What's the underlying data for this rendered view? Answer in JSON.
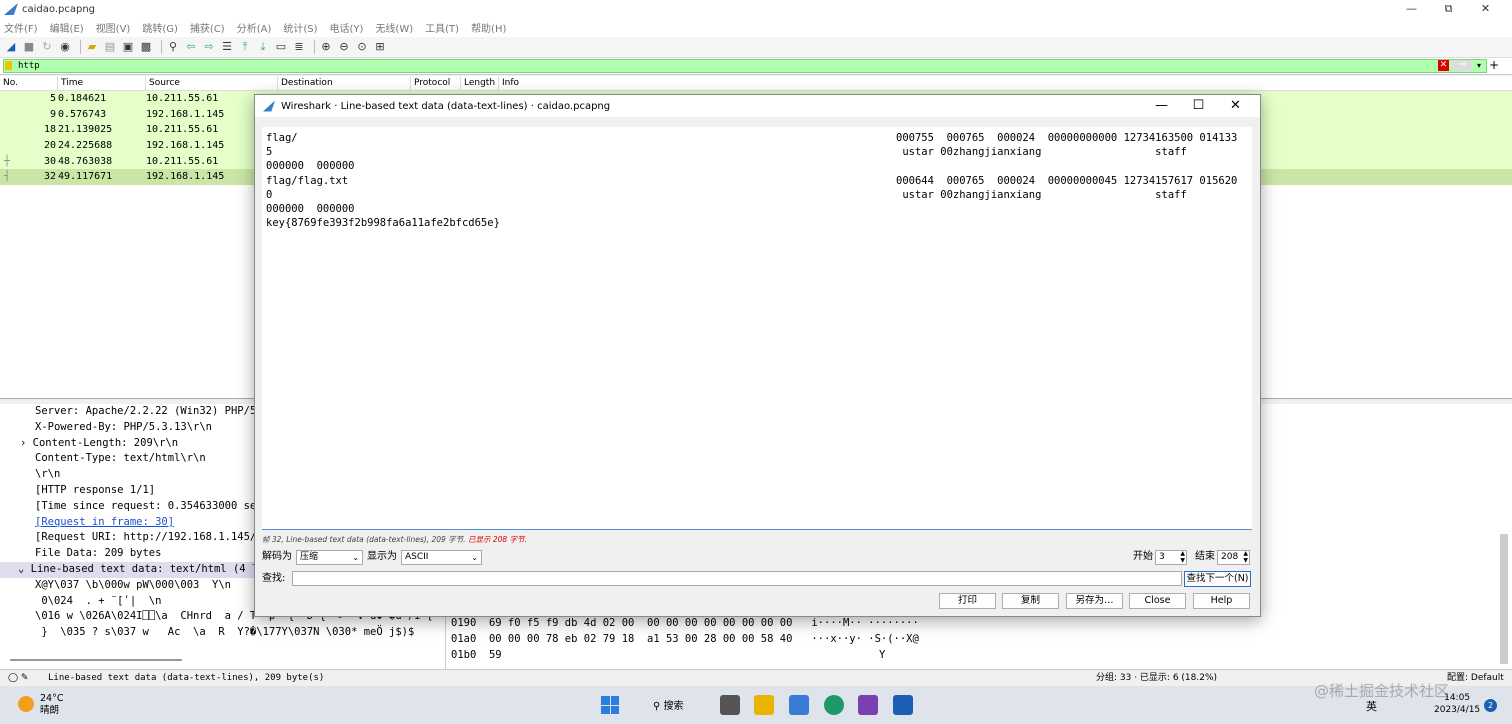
{
  "app": {
    "title": "caidao.pcapng",
    "controls": [
      "—",
      "⧉",
      "✕"
    ]
  },
  "menu": [
    "文件(F)",
    "编辑(E)",
    "视图(V)",
    "跳转(G)",
    "捕获(C)",
    "分析(A)",
    "统计(S)",
    "电话(Y)",
    "无线(W)",
    "工具(T)",
    "帮助(H)"
  ],
  "filter": {
    "value": "http",
    "clear": "✕",
    "apply": "⇒",
    "more": "▾",
    "add": "+"
  },
  "columns": [
    "No.",
    "Time",
    "Source",
    "Destination",
    "Protocol",
    "Length",
    "Info"
  ],
  "packets": [
    {
      "no": "5",
      "time": "0.184621",
      "src": "10.211.55.61",
      "mark": ""
    },
    {
      "no": "9",
      "time": "0.576743",
      "src": "192.168.1.145",
      "mark": ""
    },
    {
      "no": "18",
      "time": "21.139025",
      "src": "10.211.55.61",
      "mark": ""
    },
    {
      "no": "20",
      "time": "24.225688",
      "src": "192.168.1.145",
      "mark": ""
    },
    {
      "no": "30",
      "time": "48.763038",
      "src": "10.211.55.61",
      "mark": "┼"
    },
    {
      "no": "32",
      "time": "49.117671",
      "src": "192.168.1.145",
      "mark": "┤"
    }
  ],
  "details": [
    "Server: Apache/2.2.22 (Win32) PHP/5",
    "X-Powered-By: PHP/5.3.13\\r\\n",
    "Content-Length: 209\\r\\n",
    "Content-Type: text/html\\r\\n",
    "\\r\\n",
    "[HTTP response 1/1]",
    "[Time since request: 0.354633000 se",
    "[Request in frame: 30]",
    "[Request URI: http://192.168.1.145/",
    "File Data: 209 bytes",
    "Line-based text data: text/html (4 li",
    "X@Y\\037 \\b\\000w pW\\000\\003  Y\\n",
    " 0\\024  . + ̈ [ʹ|  \\n",
    "\\016 w \\026A\\024I⎕⎕\\a  CHnrd  a / T  p ·{  D {  >  V u◆=�u /I [",
    " }  \\035 ? s\\037 w   Ac  \\a  R  Y?�\\177Y\\037N \\030* meÖ j$)$"
  ],
  "hex": [
    {
      "off": "0190",
      "bytes": "69 f0 f5 f9 db 4d 02 00  00 00 00 00 00 00 00 00",
      "ascii": "i····M·· ········"
    },
    {
      "off": "01a0",
      "bytes": "00 00 00 78 eb 02 79 18  a1 53 00 28 00 00 58 40",
      "ascii": "···x··y· ·S·(··X@"
    },
    {
      "off": "01b0",
      "bytes": "59",
      "ascii": "Y"
    }
  ],
  "status": {
    "left": "Line-based text data (data-text-lines), 209 byte(s)",
    "mid": "分组: 33 · 已显示: 6 (18.2%)",
    "right": "配置: Default"
  },
  "dialog": {
    "title": "Wireshark · Line-based text data (data-text-lines) · caidao.pcapng",
    "controls": [
      "—",
      "☐",
      "✕"
    ],
    "lines": [
      {
        "l": "flag/",
        "r": "000755  000765  000024  00000000000 12734163500 014133"
      },
      {
        "l": "5",
        "r": " ustar 00zhangjianxiang                  staff"
      },
      {
        "l": "000000  000000",
        "r": ""
      },
      {
        "l": "flag/flag.txt",
        "r": "000644  000765  000024  00000000045 12734157617 015620"
      },
      {
        "l": "0",
        "r": " ustar 00zhangjianxiang                  staff"
      },
      {
        "l": "000000  000000",
        "r": ""
      },
      {
        "l": "key{8769fe393f2b998fa6a11afe2bfcd65e}",
        "r": ""
      }
    ],
    "info": "帧 32, Line-based text data (data-text-lines), 209 字节.",
    "info_red": "已显示 208 字节.",
    "decode_label": "解码为",
    "decode_value": "压缩",
    "show_label": "显示为",
    "show_value": "ASCII",
    "start_label": "开始",
    "start_value": "3",
    "end_label": "结束",
    "end_value": "208",
    "find_label": "查找:",
    "find_value": "",
    "find_next": "查找下一个(N)",
    "buttons": [
      "打印",
      "复制",
      "另存为…",
      "Close",
      "Help"
    ]
  },
  "taskbar": {
    "temp": "24°C",
    "weather": "晴朗",
    "search": "搜索",
    "time": "14:05",
    "date": "2023/4/15",
    "badge": "2",
    "lang": "英",
    "watermark": "@稀土掘金技术社区"
  }
}
